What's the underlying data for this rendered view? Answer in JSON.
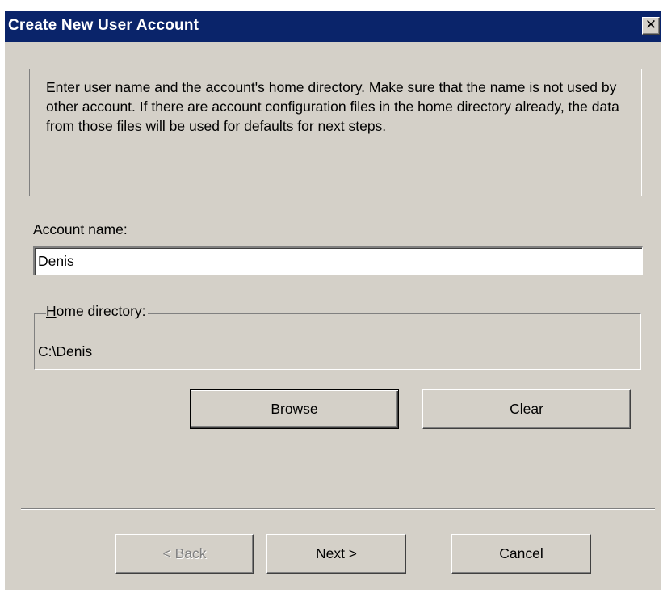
{
  "window": {
    "title": "Create New User Account",
    "close_glyph": "✕"
  },
  "info": {
    "text": "Enter user name and the account's home directory. Make sure that the name is not used by other account. If there are account configuration files in the home directory already, the data from those files will be used for defaults for next steps."
  },
  "account": {
    "label": "Account name:",
    "value": "Denis"
  },
  "home": {
    "label_underlined": "H",
    "label_rest": "ome directory:",
    "value": "C:\\Denis"
  },
  "buttons": {
    "browse": "Browse",
    "clear": "Clear",
    "back": "<  Back",
    "next": "Next  >",
    "cancel": "Cancel"
  },
  "colors": {
    "titlebar": "#0a246a",
    "face": "#d4d0c8"
  }
}
